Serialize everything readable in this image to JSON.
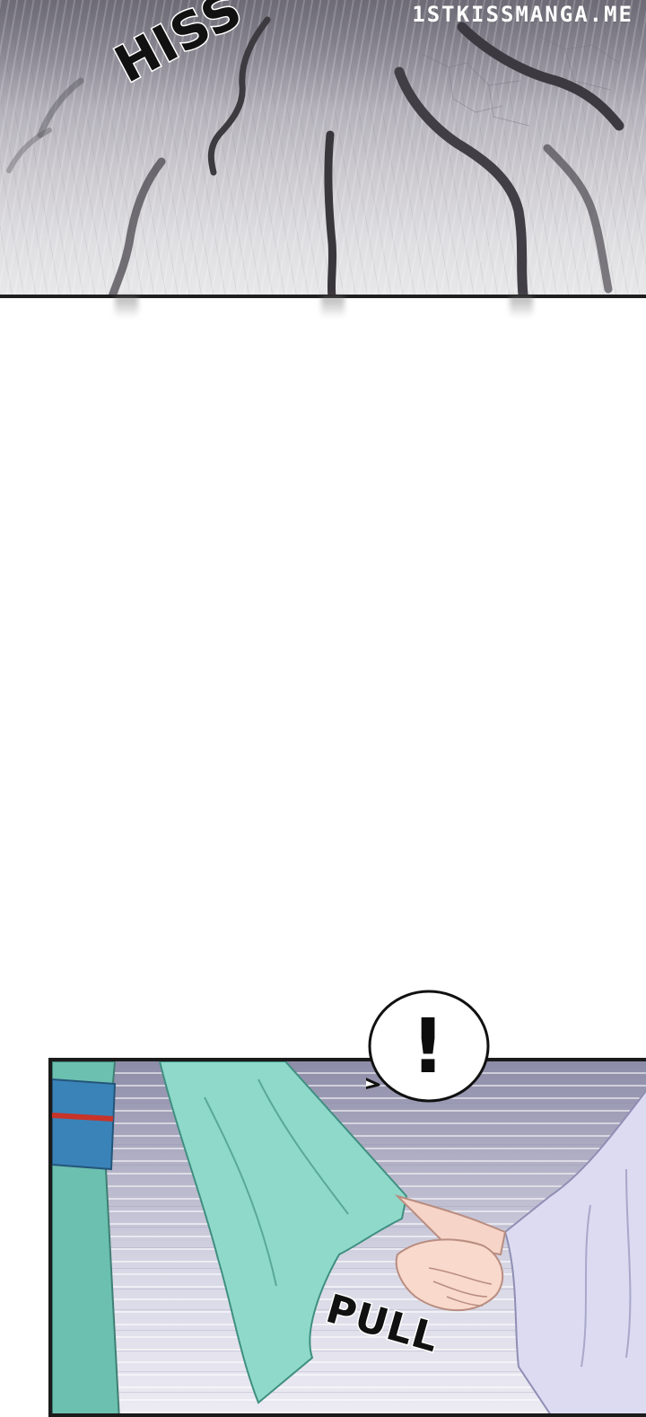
{
  "watermark": "1STKISSMANGA.ME",
  "panels": {
    "top": {
      "sfx": "HISS"
    },
    "bottom": {
      "speech": "!",
      "sfx": "PULL"
    }
  },
  "colors": {
    "panel_border": "#1b1b1b",
    "robe_teal": "#7fcfc0",
    "robe_lavender": "#d9d8f0",
    "skin": "#f6d4c8",
    "belt_blue": "#3a83b8",
    "belt_red": "#c8332a"
  }
}
